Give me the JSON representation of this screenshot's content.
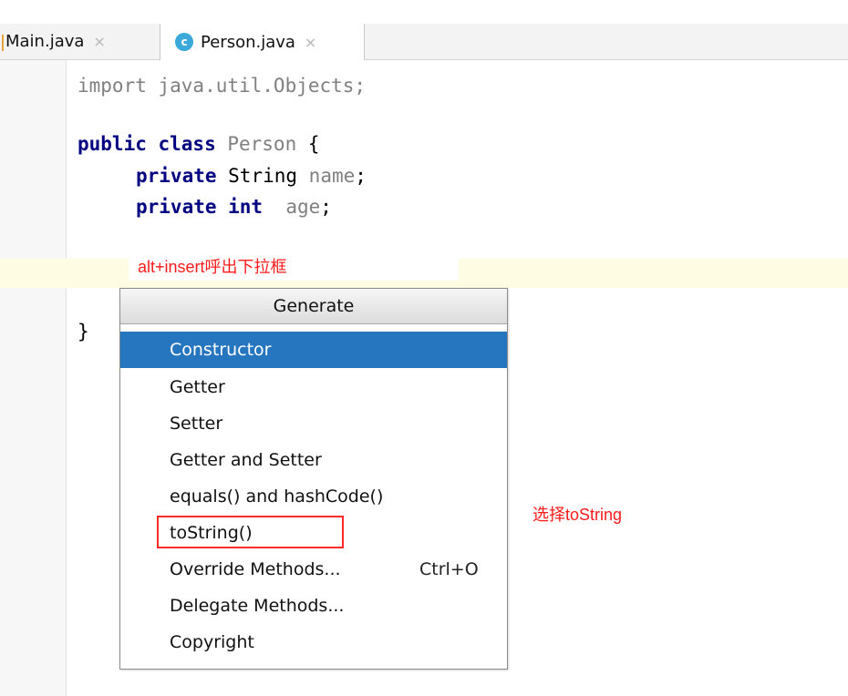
{
  "tabs": [
    {
      "label": "Main.java",
      "close": "×"
    },
    {
      "label": "Person.java",
      "close": "×",
      "icon": "class-icon",
      "icon_text": "c"
    }
  ],
  "code": {
    "line1": {
      "kw": "import",
      "rest": " java.util.Objects;"
    },
    "line3": {
      "kw": "public class",
      "name": " Person",
      "rest": " {"
    },
    "line4": {
      "kw": "private",
      "type": " String",
      "name": " name",
      "rest": ";"
    },
    "line5": {
      "kw": "private int",
      "name": "  age",
      "rest": ";"
    },
    "line7": {
      "brace": "}"
    }
  },
  "annotations": {
    "alt_insert": "alt+insert呼出下拉框",
    "choose": "选择toString"
  },
  "popup": {
    "title": "Generate",
    "items": [
      {
        "label": "Constructor",
        "selected": true
      },
      {
        "label": "Getter"
      },
      {
        "label": "Setter"
      },
      {
        "label": "Getter and Setter"
      },
      {
        "label": "equals() and hashCode()"
      },
      {
        "label": "toString()"
      },
      {
        "label": "Override Methods...",
        "shortcut": "Ctrl+O"
      },
      {
        "label": "Delegate Methods..."
      },
      {
        "label": "Copyright"
      }
    ]
  },
  "colors": {
    "selected": "#2675bf",
    "annotation": "#ff1a1a",
    "keyword": "#000080"
  }
}
